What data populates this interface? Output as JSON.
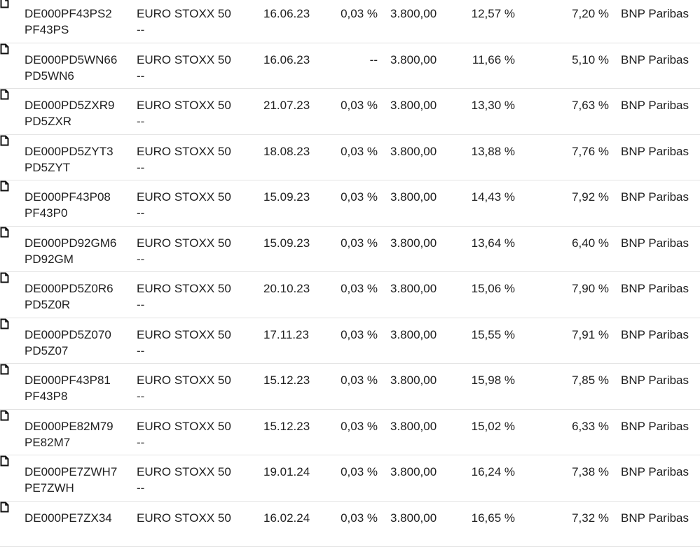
{
  "rows": [
    {
      "isin": "DE000PF43PS2",
      "wkn": "PF43PS",
      "underlying": "EURO STOXX 50",
      "underlying_sub": "--",
      "date": "16.06.23",
      "fee": "0,03 %",
      "cap": "3.800,00",
      "max_yield": "12,57 %",
      "sideways_yield": "7,20 %",
      "issuer": "BNP Paribas"
    },
    {
      "isin": "DE000PD5WN66",
      "wkn": "PD5WN6",
      "underlying": "EURO STOXX 50",
      "underlying_sub": "--",
      "date": "16.06.23",
      "fee": "--",
      "cap": "3.800,00",
      "max_yield": "11,66 %",
      "sideways_yield": "5,10 %",
      "issuer": "BNP Paribas"
    },
    {
      "isin": "DE000PD5ZXR9",
      "wkn": "PD5ZXR",
      "underlying": "EURO STOXX 50",
      "underlying_sub": "--",
      "date": "21.07.23",
      "fee": "0,03 %",
      "cap": "3.800,00",
      "max_yield": "13,30 %",
      "sideways_yield": "7,63 %",
      "issuer": "BNP Paribas"
    },
    {
      "isin": "DE000PD5ZYT3",
      "wkn": "PD5ZYT",
      "underlying": "EURO STOXX 50",
      "underlying_sub": "--",
      "date": "18.08.23",
      "fee": "0,03 %",
      "cap": "3.800,00",
      "max_yield": "13,88 %",
      "sideways_yield": "7,76 %",
      "issuer": "BNP Paribas"
    },
    {
      "isin": "DE000PF43P08",
      "wkn": "PF43P0",
      "underlying": "EURO STOXX 50",
      "underlying_sub": "--",
      "date": "15.09.23",
      "fee": "0,03 %",
      "cap": "3.800,00",
      "max_yield": "14,43 %",
      "sideways_yield": "7,92 %",
      "issuer": "BNP Paribas"
    },
    {
      "isin": "DE000PD92GM6",
      "wkn": "PD92GM",
      "underlying": "EURO STOXX 50",
      "underlying_sub": "--",
      "date": "15.09.23",
      "fee": "0,03 %",
      "cap": "3.800,00",
      "max_yield": "13,64 %",
      "sideways_yield": "6,40 %",
      "issuer": "BNP Paribas"
    },
    {
      "isin": "DE000PD5Z0R6",
      "wkn": "PD5Z0R",
      "underlying": "EURO STOXX 50",
      "underlying_sub": "--",
      "date": "20.10.23",
      "fee": "0,03 %",
      "cap": "3.800,00",
      "max_yield": "15,06 %",
      "sideways_yield": "7,90 %",
      "issuer": "BNP Paribas"
    },
    {
      "isin": "DE000PD5Z070",
      "wkn": "PD5Z07",
      "underlying": "EURO STOXX 50",
      "underlying_sub": "--",
      "date": "17.11.23",
      "fee": "0,03 %",
      "cap": "3.800,00",
      "max_yield": "15,55 %",
      "sideways_yield": "7,91 %",
      "issuer": "BNP Paribas"
    },
    {
      "isin": "DE000PF43P81",
      "wkn": "PF43P8",
      "underlying": "EURO STOXX 50",
      "underlying_sub": "--",
      "date": "15.12.23",
      "fee": "0,03 %",
      "cap": "3.800,00",
      "max_yield": "15,98 %",
      "sideways_yield": "7,85 %",
      "issuer": "BNP Paribas"
    },
    {
      "isin": "DE000PE82M79",
      "wkn": "PE82M7",
      "underlying": "EURO STOXX 50",
      "underlying_sub": "--",
      "date": "15.12.23",
      "fee": "0,03 %",
      "cap": "3.800,00",
      "max_yield": "15,02 %",
      "sideways_yield": "6,33 %",
      "issuer": "BNP Paribas"
    },
    {
      "isin": "DE000PE7ZWH7",
      "wkn": "PE7ZWH",
      "underlying": "EURO STOXX 50",
      "underlying_sub": "--",
      "date": "19.01.24",
      "fee": "0,03 %",
      "cap": "3.800,00",
      "max_yield": "16,24 %",
      "sideways_yield": "7,38 %",
      "issuer": "BNP Paribas"
    },
    {
      "isin": "DE000PE7ZX34",
      "wkn": "",
      "underlying": "EURO STOXX 50",
      "underlying_sub": "",
      "date": "16.02.24",
      "fee": "0,03 %",
      "cap": "3.800,00",
      "max_yield": "16,65 %",
      "sideways_yield": "7,32 %",
      "issuer": "BNP Paribas"
    }
  ],
  "icons": {
    "row_icon": "document-icon"
  }
}
